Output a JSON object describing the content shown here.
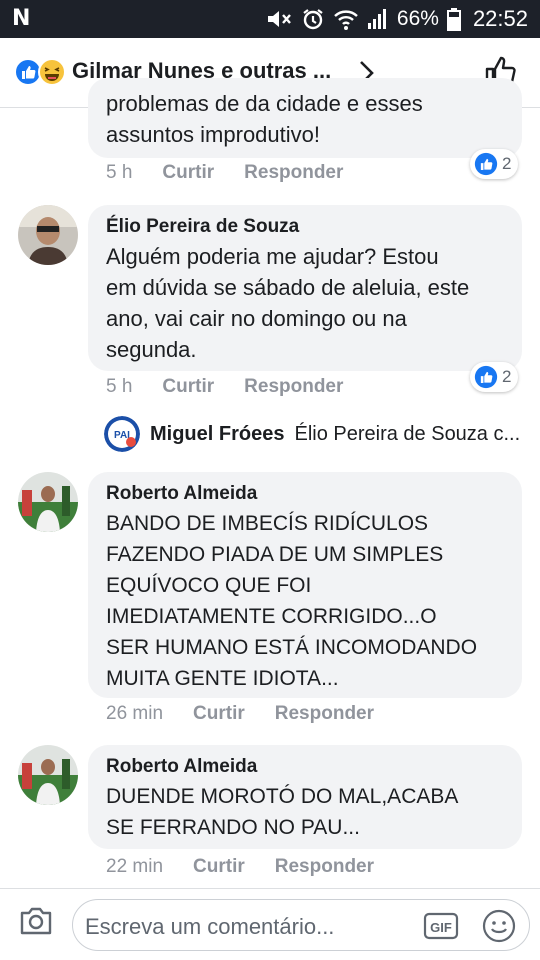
{
  "status_bar": {
    "carrier_logo": "N",
    "battery_pct": "66%",
    "time": "22:52",
    "icons": [
      "mute-icon",
      "alarm-icon",
      "wifi-icon",
      "signal-icon",
      "battery-icon"
    ]
  },
  "header": {
    "title": "Gilmar Nunes e outras ...",
    "reaction_icons": [
      "like-reaction-icon",
      "haha-reaction-icon"
    ]
  },
  "comments": [
    {
      "author": "",
      "text": "problemas de da cidade e esses\nassuntos improdutivo!",
      "time": "5 h",
      "like_label": "Curtir",
      "reply_label": "Responder",
      "reaction_count": "2"
    },
    {
      "author": "Élio Pereira de Souza",
      "text": "Alguém poderia me ajudar? Estou\nem dúvida se sábado de aleluia, este\nano, vai cair no domingo ou na\nsegunda.",
      "time": "5 h",
      "like_label": "Curtir",
      "reply_label": "Responder",
      "reaction_count": "2"
    },
    {
      "author": "Roberto Almeida",
      "text": "BANDO DE IMBECÍS RIDÍCULOS\nFAZENDO PIADA DE UM SIMPLES\nEQUÍVOCO QUE FOI\nIMEDIATAMENTE CORRIGIDO...O\nSER HUMANO ESTÁ INCOMODANDO\nMUITA GENTE IDIOTA...",
      "time": "26 min",
      "like_label": "Curtir",
      "reply_label": "Responder"
    },
    {
      "author": "Roberto Almeida",
      "text": "DUENDE MOROTÓ DO MAL,ACABA\nSE FERRANDO NO PAU...",
      "time": "22 min",
      "like_label": "Curtir",
      "reply_label": "Responder"
    }
  ],
  "reply_preview": {
    "author": "Miguel Fróees",
    "snippet": "Élio Pereira de Souza c...",
    "avatar_text": "PAI"
  },
  "composer": {
    "placeholder": "Escreva um comentário...",
    "gif_label": "GIF"
  },
  "colors": {
    "status_bar": "#1d2129",
    "bubble": "#f2f3f5",
    "meta_text": "#90949c",
    "like_blue": "#1877f2"
  }
}
